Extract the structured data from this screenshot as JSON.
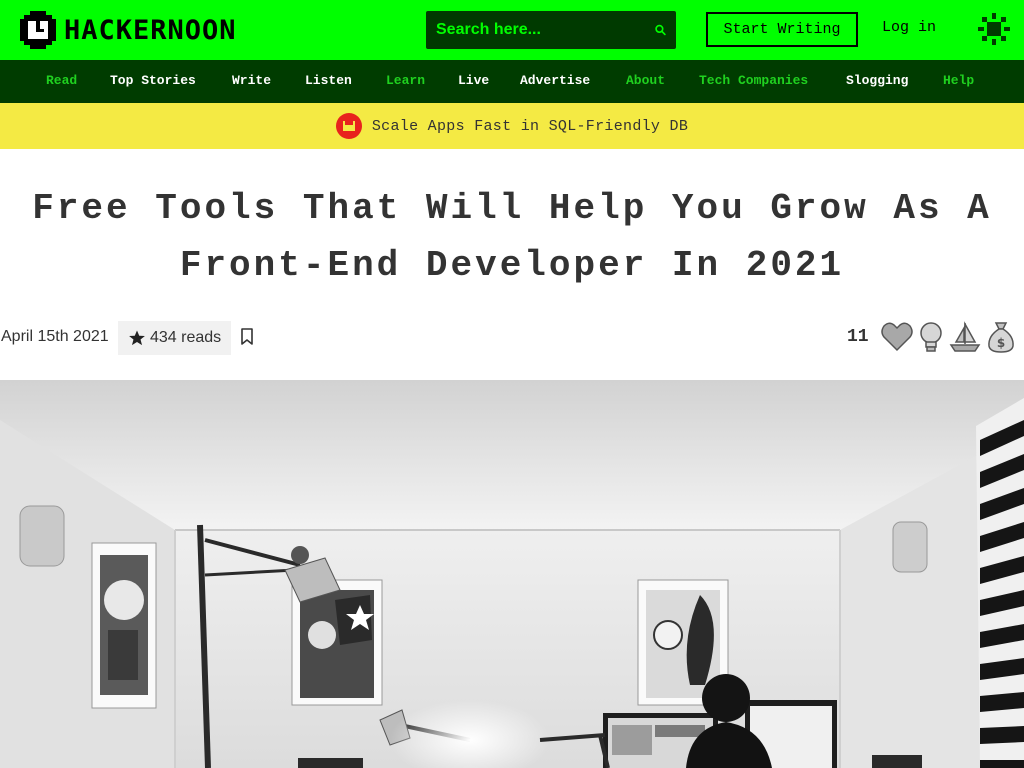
{
  "header": {
    "logo_text": "HACKERNOON",
    "search_placeholder": "Search here...",
    "start_writing_label": "Start Writing",
    "login_label": "Log in",
    "brand_color": "#00ff00",
    "icons": {
      "logo": "hackernoon-logo-icon",
      "search": "search-icon",
      "theme": "sun-icon"
    }
  },
  "nav": {
    "items": [
      {
        "label": "Read",
        "color": "green"
      },
      {
        "label": "Top Stories",
        "color": "white"
      },
      {
        "label": "Write",
        "color": "white"
      },
      {
        "label": "Listen",
        "color": "white"
      },
      {
        "label": "Learn",
        "color": "green"
      },
      {
        "label": "Live",
        "color": "white"
      },
      {
        "label": "Advertise",
        "color": "white"
      },
      {
        "label": "About",
        "color": "green"
      },
      {
        "label": "Tech Companies",
        "color": "green"
      },
      {
        "label": "Slogging",
        "color": "white"
      },
      {
        "label": "Help",
        "color": "green"
      }
    ]
  },
  "promo": {
    "text": "Scale Apps Fast in SQL-Friendly DB",
    "icon": "cockroach-db-icon",
    "background": "#f4ea44"
  },
  "article": {
    "title_line1": "Free Tools That Will Help You Grow As A",
    "title_line2": "Front-End Developer In 2021",
    "date": "April 15th 2021",
    "reads": "434 reads",
    "reaction_count": "11",
    "reactions": [
      "heart-icon",
      "lightbulb-icon",
      "boat-icon",
      "money-bag-icon"
    ],
    "hero_image": "office-desk-photo"
  }
}
